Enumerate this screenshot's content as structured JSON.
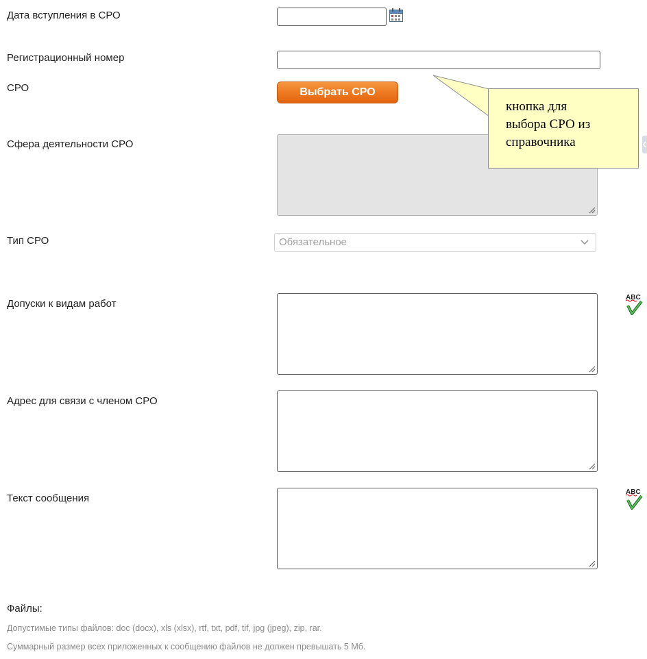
{
  "fields": {
    "join_date": {
      "label": "Дата вступления в СРО",
      "value": ""
    },
    "reg_number": {
      "label": "Регистрационный номер",
      "value": ""
    },
    "sro": {
      "label": "СРО",
      "button": "Выбрать СРО"
    },
    "activity_sphere": {
      "label": "Сфера деятельности СРО"
    },
    "sro_type": {
      "label": "Тип СРО",
      "selected": "Обязательное"
    },
    "work_permits": {
      "label": "Допуски к видам работ"
    },
    "contact_address": {
      "label": "Адрес для связи с членом СРО"
    },
    "message_text": {
      "label": "Текст сообщения"
    }
  },
  "callout": {
    "lines": [
      "кнопка для",
      "выбора СРО из",
      "справочника"
    ]
  },
  "files": {
    "title": "Файлы:",
    "allowed_types": "Допустимые типы файлов: doc (docx), xls (xlsx), rtf, txt, pdf, tif, jpg (jpeg), zip, rar.",
    "size_limit": "Суммарный размер всех приложенных к сообщению файлов не должен превышать 5 Мб."
  },
  "icons": {
    "calendar": "calendar-icon",
    "spellcheck": "spellcheck-abc-icon",
    "dropdown": "chevron-down-icon",
    "resize": "resize-grip-icon"
  },
  "colors": {
    "button_orange": "#ee7a22",
    "callout_bg": "#ffffc4",
    "disabled_bg": "#e4e4e4"
  }
}
